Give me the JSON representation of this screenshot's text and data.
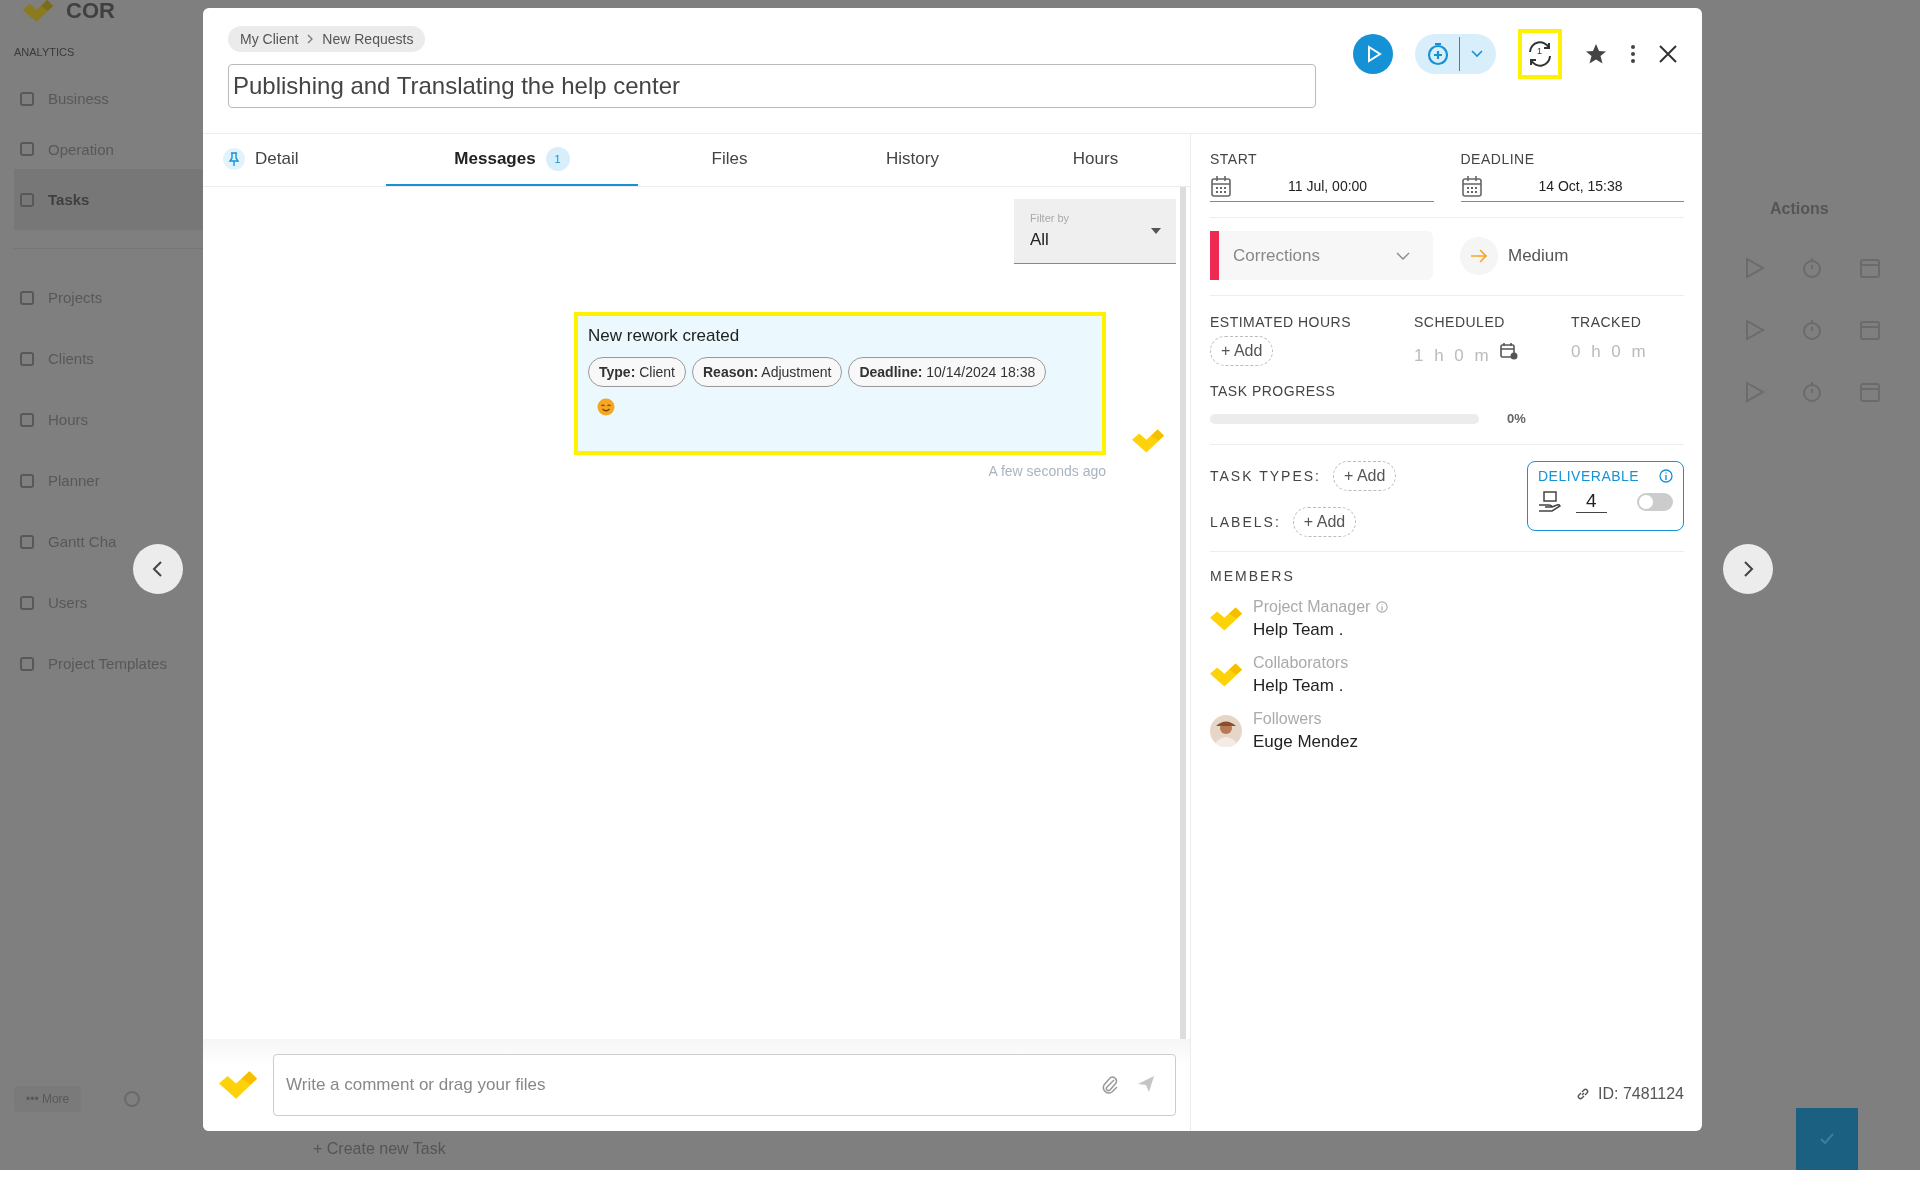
{
  "background": {
    "logo_text": "COR",
    "sidebar": {
      "section": "ANALYTICS",
      "items": [
        {
          "label": "Business",
          "selected": false
        },
        {
          "label": "Operation",
          "selected": false
        },
        {
          "label": "Tasks",
          "selected": true
        },
        {
          "label": "Projects",
          "selected": false
        },
        {
          "label": "Clients",
          "selected": false
        },
        {
          "label": "Hours",
          "selected": false
        },
        {
          "label": "Planner",
          "selected": false
        },
        {
          "label": "Gantt Cha",
          "selected": false
        },
        {
          "label": "Users",
          "selected": false
        },
        {
          "label": "Project Templates",
          "selected": false
        }
      ],
      "more_button": "••• More"
    },
    "actions_header": "Actions",
    "create_task": "+ Create new Task"
  },
  "modal": {
    "breadcrumb": [
      "My Client",
      "New Requests"
    ],
    "title": "Publishing and Translating the help center",
    "sync_badge": "1",
    "tabs": [
      {
        "label": "Detail",
        "selected": false
      },
      {
        "label": "Messages",
        "selected": true,
        "badge": "1"
      },
      {
        "label": "Files",
        "selected": false
      },
      {
        "label": "History",
        "selected": false
      },
      {
        "label": "Hours",
        "selected": false
      }
    ],
    "filter": {
      "label": "Filter by",
      "value": "All"
    },
    "messages": [
      {
        "title": "New rework created",
        "highlighted": true,
        "chips": [
          {
            "key": "Type:",
            "value": "Client"
          },
          {
            "key": "Reason:",
            "value": "Adjustment"
          },
          {
            "key": "Deadline:",
            "value": "10/14/2024 18:38"
          }
        ],
        "time": "A few seconds ago"
      }
    ],
    "composer": {
      "placeholder": "Write a comment or drag your files"
    },
    "details": {
      "start": {
        "label": "START",
        "value": "11 Jul, 00:00"
      },
      "deadline": {
        "label": "DEADLINE",
        "value": "14 Oct, 15:38"
      },
      "status": {
        "value": "Corrections",
        "color": "#ee2a53"
      },
      "priority": {
        "value": "Medium"
      },
      "hours": [
        {
          "label": "ESTIMATED HOURS",
          "kind": "add",
          "value": "+ Add"
        },
        {
          "label": "SCHEDULED",
          "kind": "scheduled",
          "value": "1 h 0 m"
        },
        {
          "label": "TRACKED",
          "kind": "plain",
          "value": "0 h 0 m"
        }
      ],
      "progress": {
        "label": "TASK PROGRESS",
        "level": 0,
        "reading": "0%"
      },
      "task_types": {
        "label": "TASK TYPES:",
        "button": "+ Add"
      },
      "labels": {
        "label": "LABELS:",
        "button": "+ Add"
      },
      "deliverable": {
        "label": "DELIVERABLE",
        "value": "4",
        "on": false
      },
      "members_label": "MEMBERS",
      "members": [
        {
          "role": "Project Manager",
          "name": "Help Team .",
          "kind": "team",
          "info": true
        },
        {
          "role": "Collaborators",
          "name": "Help Team .",
          "kind": "team",
          "info": false
        },
        {
          "role": "Followers",
          "name": "Euge Mendez",
          "kind": "person",
          "info": false
        }
      ],
      "id": "ID: 7481124"
    }
  }
}
